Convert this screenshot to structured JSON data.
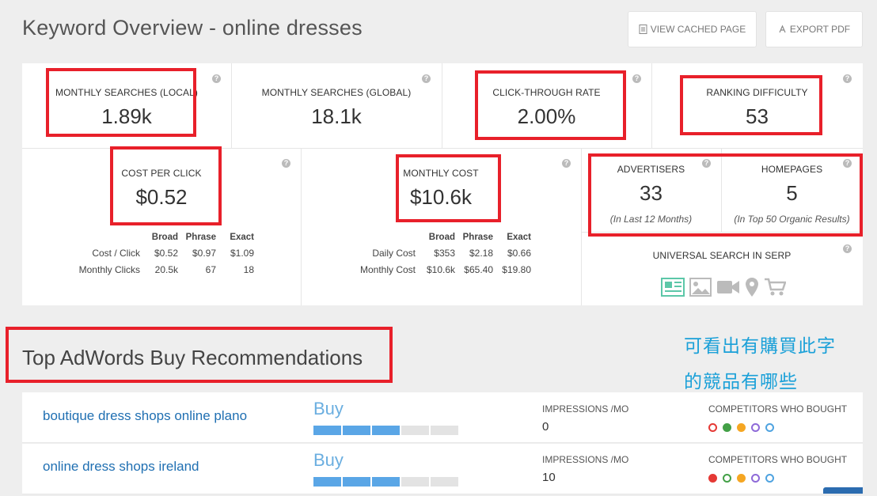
{
  "header": {
    "title": "Keyword Overview - online dresses",
    "cached_btn": "VIEW CACHED PAGE",
    "pdf_btn": "EXPORT PDF"
  },
  "metrics": {
    "monthly_local": {
      "label": "MONTHLY SEARCHES (LOCAL)",
      "value": "1.89k"
    },
    "monthly_global": {
      "label": "MONTHLY SEARCHES (GLOBAL)",
      "value": "18.1k"
    },
    "ctr": {
      "label": "CLICK-THROUGH RATE",
      "value": "2.00%"
    },
    "difficulty": {
      "label": "RANKING DIFFICULTY",
      "value": "53"
    },
    "cpc": {
      "label": "COST PER CLICK",
      "value": "$0.52"
    },
    "monthly_cost": {
      "label": "MONTHLY COST",
      "value": "$10.6k"
    },
    "advertisers": {
      "label": "ADVERTISERS",
      "value": "33",
      "sub": "(In Last 12 Months)"
    },
    "homepages": {
      "label": "HOMEPAGES",
      "value": "5",
      "sub": "(In Top 50 Organic Results)"
    },
    "serp": {
      "label": "UNIVERSAL SEARCH IN SERP",
      "icons": [
        "news-icon",
        "image-icon",
        "video-icon",
        "map-pin-icon",
        "shopping-cart-icon"
      ]
    }
  },
  "cpc_table": {
    "headers": [
      "Broad",
      "Phrase",
      "Exact"
    ],
    "rows": [
      {
        "label": "Cost / Click",
        "broad": "$0.52",
        "phrase": "$0.97",
        "exact": "$1.09"
      },
      {
        "label": "Monthly Clicks",
        "broad": "20.5k",
        "phrase": "67",
        "exact": "18"
      }
    ]
  },
  "cost_table": {
    "headers": [
      "Broad",
      "Phrase",
      "Exact"
    ],
    "rows": [
      {
        "label": "Daily Cost",
        "broad": "$353",
        "phrase": "$2.18",
        "exact": "$0.66"
      },
      {
        "label": "Monthly Cost",
        "broad": "$10.6k",
        "phrase": "$65.40",
        "exact": "$19.80"
      }
    ]
  },
  "recommendations": {
    "title": "Top AdWords Buy Recommendations",
    "note_line1": "可看出有購買此字",
    "note_line2": "的競品有哪些",
    "impressions_label": "IMPRESSIONS /MO",
    "competitors_label": "COMPETITORS WHO BOUGHT",
    "rows": [
      {
        "keyword": "boutique dress shops online plano",
        "action": "Buy",
        "strength": 0.5,
        "impressions": "0"
      },
      {
        "keyword": "online dress shops ireland",
        "action": "Buy",
        "strength": 0.5,
        "impressions": "10"
      }
    ]
  },
  "colors": {
    "highlight": "#e8202a",
    "link": "#1f6fb2",
    "buy": "#6aaee0",
    "bar_on": "#5aa6e6",
    "note": "#1aa0d8",
    "dots": [
      "#e53935",
      "#43a047",
      "#f5a623",
      "#8e6ad8",
      "#4fa3e0"
    ]
  }
}
